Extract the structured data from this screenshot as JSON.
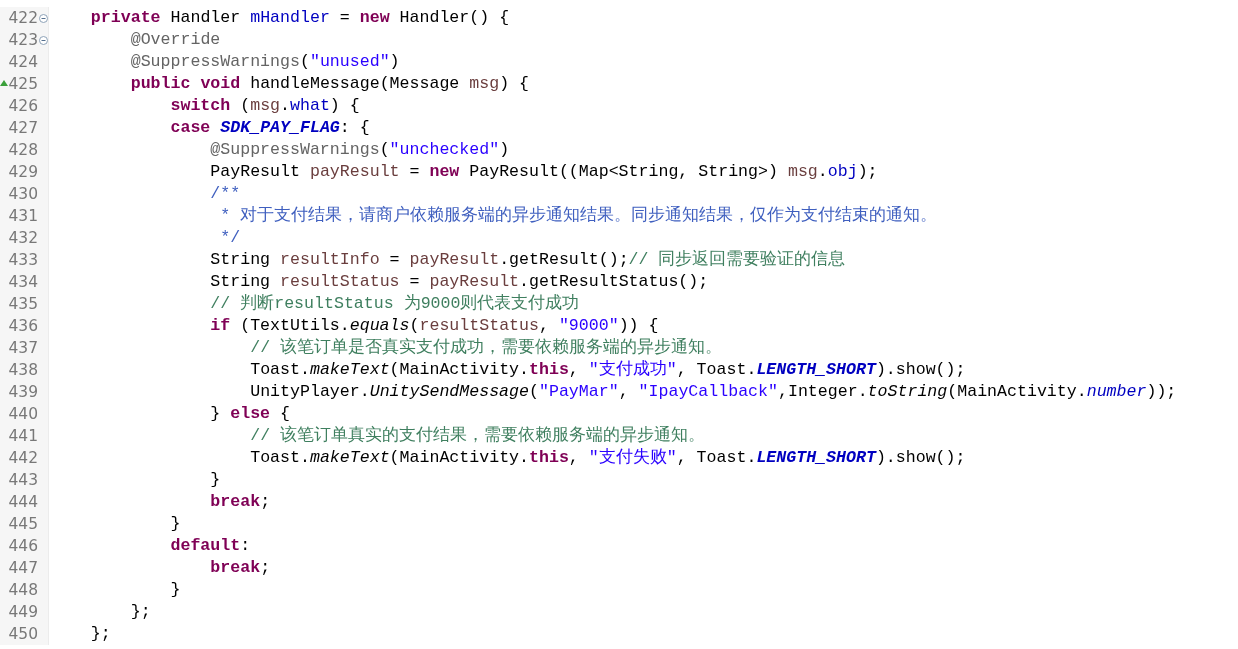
{
  "editor": {
    "lines": [
      {
        "number": "422",
        "fold": true,
        "tokens": [
          {
            "kind": "keyword",
            "text": "    private"
          },
          {
            "kind": "plain",
            "text": " Handler "
          },
          {
            "kind": "field",
            "text": "mHandler"
          },
          {
            "kind": "plain",
            "text": " = "
          },
          {
            "kind": "keyword",
            "text": "new"
          },
          {
            "kind": "plain",
            "text": " Handler() {"
          }
        ]
      },
      {
        "number": "423",
        "fold": true,
        "tokens": [
          {
            "kind": "annotation",
            "text": "        @Override"
          }
        ]
      },
      {
        "number": "424",
        "tokens": [
          {
            "kind": "annotation",
            "text": "        @SuppressWarnings"
          },
          {
            "kind": "plain",
            "text": "("
          },
          {
            "kind": "string",
            "text": "\"unused\""
          },
          {
            "kind": "plain",
            "text": ")"
          }
        ]
      },
      {
        "number": "425",
        "override": true,
        "tokens": [
          {
            "kind": "keyword",
            "text": "        public "
          },
          {
            "kind": "keyword",
            "text": "void"
          },
          {
            "kind": "plain",
            "text": " handleMessage(Message "
          },
          {
            "kind": "local",
            "text": "msg"
          },
          {
            "kind": "plain",
            "text": ") {"
          }
        ]
      },
      {
        "number": "426",
        "tokens": [
          {
            "kind": "keyword",
            "text": "            switch"
          },
          {
            "kind": "plain",
            "text": " ("
          },
          {
            "kind": "local",
            "text": "msg"
          },
          {
            "kind": "plain",
            "text": "."
          },
          {
            "kind": "field",
            "text": "what"
          },
          {
            "kind": "plain",
            "text": ") {"
          }
        ]
      },
      {
        "number": "427",
        "tokens": [
          {
            "kind": "keyword",
            "text": "            case "
          },
          {
            "kind": "constant",
            "text": "SDK_PAY_FLAG"
          },
          {
            "kind": "plain",
            "text": ": {"
          }
        ]
      },
      {
        "number": "428",
        "tokens": [
          {
            "kind": "annotation",
            "text": "                @SuppressWarnings"
          },
          {
            "kind": "plain",
            "text": "("
          },
          {
            "kind": "string",
            "text": "\"unchecked\""
          },
          {
            "kind": "plain",
            "text": ")"
          }
        ]
      },
      {
        "number": "429",
        "tokens": [
          {
            "kind": "plain",
            "text": "                PayResult "
          },
          {
            "kind": "local",
            "text": "payResult"
          },
          {
            "kind": "plain",
            "text": " = "
          },
          {
            "kind": "keyword",
            "text": "new"
          },
          {
            "kind": "plain",
            "text": " PayResult((Map<String, String>) "
          },
          {
            "kind": "local",
            "text": "msg"
          },
          {
            "kind": "plain",
            "text": "."
          },
          {
            "kind": "field",
            "text": "obj"
          },
          {
            "kind": "plain",
            "text": ");"
          }
        ]
      },
      {
        "number": "430",
        "tokens": [
          {
            "kind": "javadoc",
            "text": "                /**"
          }
        ]
      },
      {
        "number": "431",
        "tokens": [
          {
            "kind": "javadoc",
            "text": "                 * 对于支付结果，请商户依赖服务端的异步通知结果。同步通知结果，仅作为支付结束的通知。"
          }
        ]
      },
      {
        "number": "432",
        "tokens": [
          {
            "kind": "javadoc",
            "text": "                 */"
          }
        ]
      },
      {
        "number": "433",
        "tokens": [
          {
            "kind": "plain",
            "text": "                String "
          },
          {
            "kind": "local",
            "text": "resultInfo"
          },
          {
            "kind": "plain",
            "text": " = "
          },
          {
            "kind": "local",
            "text": "payResult"
          },
          {
            "kind": "plain",
            "text": ".getResult();"
          },
          {
            "kind": "comment",
            "text": "// 同步返回需要验证的信息"
          }
        ]
      },
      {
        "number": "434",
        "tokens": [
          {
            "kind": "plain",
            "text": "                String "
          },
          {
            "kind": "local",
            "text": "resultStatus"
          },
          {
            "kind": "plain",
            "text": " = "
          },
          {
            "kind": "local",
            "text": "payResult"
          },
          {
            "kind": "plain",
            "text": ".getResultStatus();"
          }
        ]
      },
      {
        "number": "435",
        "tokens": [
          {
            "kind": "comment",
            "text": "                // 判断resultStatus 为9000则代表支付成功"
          }
        ]
      },
      {
        "number": "436",
        "tokens": [
          {
            "kind": "keyword",
            "text": "                if"
          },
          {
            "kind": "plain",
            "text": " (TextUtils."
          },
          {
            "kind": "method",
            "text": "equals"
          },
          {
            "kind": "plain",
            "text": "("
          },
          {
            "kind": "local",
            "text": "resultStatus"
          },
          {
            "kind": "plain",
            "text": ", "
          },
          {
            "kind": "string",
            "text": "\"9000\""
          },
          {
            "kind": "plain",
            "text": ")) {"
          }
        ]
      },
      {
        "number": "437",
        "tokens": [
          {
            "kind": "comment",
            "text": "                    // 该笔订单是否真实支付成功，需要依赖服务端的异步通知。"
          }
        ]
      },
      {
        "number": "438",
        "tokens": [
          {
            "kind": "plain",
            "text": "                    Toast."
          },
          {
            "kind": "method",
            "text": "makeText"
          },
          {
            "kind": "plain",
            "text": "(MainActivity."
          },
          {
            "kind": "keyword",
            "text": "this"
          },
          {
            "kind": "plain",
            "text": ", "
          },
          {
            "kind": "string",
            "text": "\"支付成功\""
          },
          {
            "kind": "plain",
            "text": ", Toast."
          },
          {
            "kind": "constant",
            "text": "LENGTH_SHORT"
          },
          {
            "kind": "plain",
            "text": ").show();"
          }
        ]
      },
      {
        "number": "439",
        "tokens": [
          {
            "kind": "plain",
            "text": "                    UnityPlayer."
          },
          {
            "kind": "method",
            "text": "UnitySendMessage"
          },
          {
            "kind": "plain",
            "text": "("
          },
          {
            "kind": "string",
            "text": "\"PayMar\""
          },
          {
            "kind": "plain",
            "text": ", "
          },
          {
            "kind": "string",
            "text": "\"IpayCallback\""
          },
          {
            "kind": "plain",
            "text": ",Integer."
          },
          {
            "kind": "method",
            "text": "toString"
          },
          {
            "kind": "plain",
            "text": "(MainActivity."
          },
          {
            "kind": "static",
            "text": "number"
          },
          {
            "kind": "plain",
            "text": "));"
          }
        ]
      },
      {
        "number": "440",
        "tokens": [
          {
            "kind": "plain",
            "text": "                } "
          },
          {
            "kind": "keyword",
            "text": "else"
          },
          {
            "kind": "plain",
            "text": " {"
          }
        ]
      },
      {
        "number": "441",
        "tokens": [
          {
            "kind": "comment",
            "text": "                    // 该笔订单真实的支付结果，需要依赖服务端的异步通知。"
          }
        ]
      },
      {
        "number": "442",
        "tokens": [
          {
            "kind": "plain",
            "text": "                    Toast."
          },
          {
            "kind": "method",
            "text": "makeText"
          },
          {
            "kind": "plain",
            "text": "(MainActivity."
          },
          {
            "kind": "keyword",
            "text": "this"
          },
          {
            "kind": "plain",
            "text": ", "
          },
          {
            "kind": "string",
            "text": "\"支付失败\""
          },
          {
            "kind": "plain",
            "text": ", Toast."
          },
          {
            "kind": "constant",
            "text": "LENGTH_SHORT"
          },
          {
            "kind": "plain",
            "text": ").show();"
          }
        ]
      },
      {
        "number": "443",
        "tokens": [
          {
            "kind": "plain",
            "text": "                }"
          }
        ]
      },
      {
        "number": "444",
        "tokens": [
          {
            "kind": "keyword",
            "text": "                break"
          },
          {
            "kind": "plain",
            "text": ";"
          }
        ]
      },
      {
        "number": "445",
        "tokens": [
          {
            "kind": "plain",
            "text": "            }"
          }
        ]
      },
      {
        "number": "446",
        "tokens": [
          {
            "kind": "keyword",
            "text": "            default"
          },
          {
            "kind": "plain",
            "text": ":"
          }
        ]
      },
      {
        "number": "447",
        "tokens": [
          {
            "kind": "keyword",
            "text": "                break"
          },
          {
            "kind": "plain",
            "text": ";"
          }
        ]
      },
      {
        "number": "448",
        "tokens": [
          {
            "kind": "plain",
            "text": "            }"
          }
        ]
      },
      {
        "number": "449",
        "tokens": [
          {
            "kind": "plain",
            "text": "        };"
          }
        ]
      },
      {
        "number": "450",
        "tokens": [
          {
            "kind": "plain",
            "text": "    };"
          }
        ]
      }
    ]
  }
}
